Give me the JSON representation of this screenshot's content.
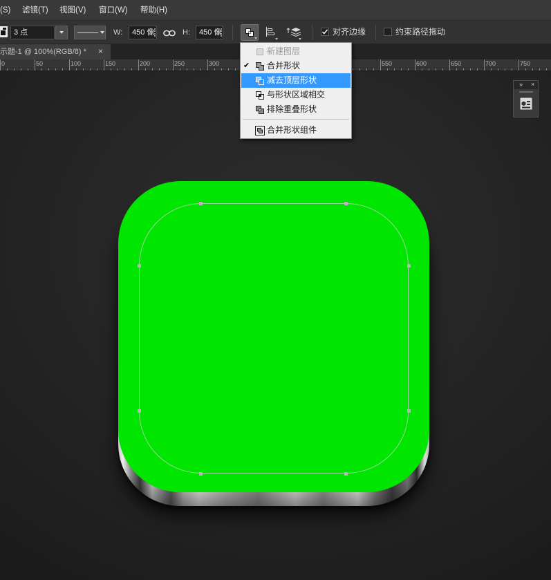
{
  "menubar": {
    "items": [
      {
        "label": "(S)"
      },
      {
        "label": "滤镜(T)"
      },
      {
        "label": "视图(V)"
      },
      {
        "label": "窗口(W)"
      },
      {
        "label": "帮助(H)"
      }
    ]
  },
  "options_bar": {
    "tool_preset_icon": "shape-tool-preset-icon",
    "stroke_width": "3 点",
    "stroke_type_icon": "stroke-line-style-icon",
    "width_label": "W:",
    "width_value": "450 像",
    "link_icon": "chain-link-icon",
    "height_label": "H:",
    "height_value": "450 像",
    "path_operations_icon": "path-operations-icon",
    "path_alignment_icon": "path-alignment-icon",
    "path_arrangement_icon": "path-arrangement-icon",
    "align_edges": {
      "label": "对齐边缘",
      "checked": true
    },
    "constrain_path_dragging": {
      "label": "约束路径拖动",
      "checked": false
    }
  },
  "document_tab": {
    "title": "示题-1 @ 100%(RGB/8) *",
    "close_glyph": "×"
  },
  "ruler": {
    "labels": [
      "0",
      "50",
      "100",
      "150",
      "200",
      "250",
      "300",
      "550",
      "600",
      "650",
      "700",
      "750"
    ]
  },
  "path_operations_menu": {
    "check_glyph": "✔",
    "items": [
      {
        "label": "新建图层",
        "icon": "new-layer-icon",
        "enabled": false,
        "checked": false,
        "highlighted": false
      },
      {
        "label": "合并形状",
        "icon": "combine-shapes-icon",
        "enabled": true,
        "checked": true,
        "highlighted": false
      },
      {
        "label": "减去顶层形状",
        "icon": "subtract-front-shape-icon",
        "enabled": true,
        "checked": false,
        "highlighted": true
      },
      {
        "label": "与形状区域相交",
        "icon": "intersect-shape-areas-icon",
        "enabled": true,
        "checked": false,
        "highlighted": false
      },
      {
        "label": "排除重叠形状",
        "icon": "exclude-overlapping-shapes-icon",
        "enabled": true,
        "checked": false,
        "highlighted": false
      },
      {
        "separator": true
      },
      {
        "label": "合并形状组件",
        "icon": "merge-shape-components-icon",
        "enabled": true,
        "checked": false,
        "highlighted": false
      }
    ]
  },
  "mini_panel": {
    "expand_glyph": "»",
    "close_glyph": "×",
    "icon": "properties-panel-icon"
  },
  "colors": {
    "shape_fill": "#00e600",
    "menu_highlight": "#3399ff"
  }
}
